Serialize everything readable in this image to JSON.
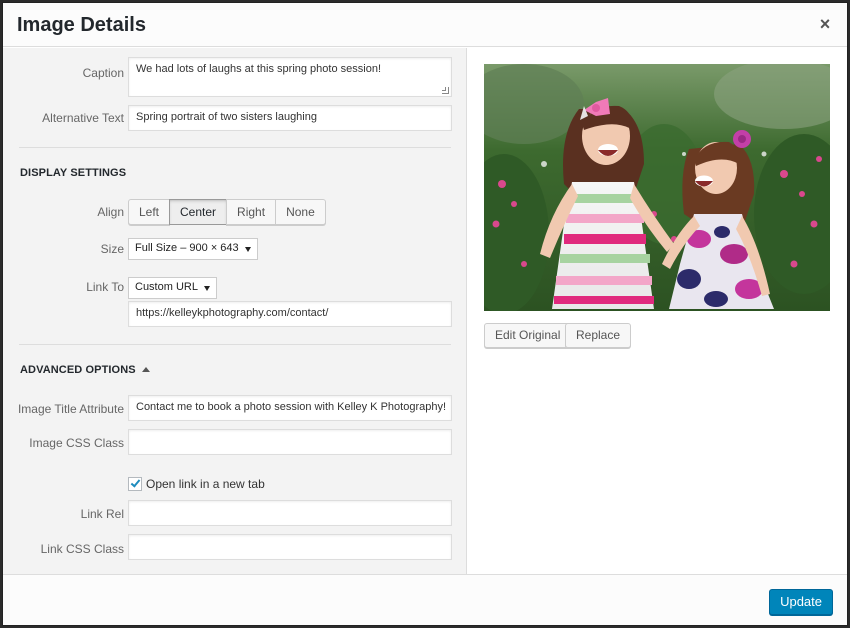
{
  "dialog": {
    "title": "Image Details",
    "close_label": "×"
  },
  "fields": {
    "caption": {
      "label": "Caption",
      "value": "We had lots of laughs at this spring photo session!"
    },
    "alt_text": {
      "label": "Alternative Text",
      "value": "Spring portrait of two sisters laughing"
    }
  },
  "display_settings": {
    "title": "DISPLAY SETTINGS",
    "align": {
      "label": "Align",
      "options": [
        "Left",
        "Center",
        "Right",
        "None"
      ],
      "selected": "Center"
    },
    "size": {
      "label": "Size",
      "value": "Full Size – 900 × 643"
    },
    "link_to": {
      "label": "Link To",
      "value": "Custom URL",
      "url": "https://kelleykphotography.com/contact/"
    }
  },
  "advanced_options": {
    "title": "ADVANCED OPTIONS",
    "title_attribute": {
      "label": "Image Title Attribute",
      "value": "Contact me to book a photo session with Kelley K Photography!"
    },
    "css_class": {
      "label": "Image CSS Class",
      "value": ""
    },
    "new_tab": {
      "label": "Open link in a new tab",
      "checked": true
    },
    "link_rel": {
      "label": "Link Rel",
      "value": ""
    },
    "link_css_class": {
      "label": "Link CSS Class",
      "value": ""
    }
  },
  "preview": {
    "edit_original_label": "Edit Original",
    "replace_label": "Replace"
  },
  "footer": {
    "update_label": "Update"
  },
  "colors": {
    "primary_button": "#0085ba",
    "accent_check": "#1e8cbe"
  }
}
